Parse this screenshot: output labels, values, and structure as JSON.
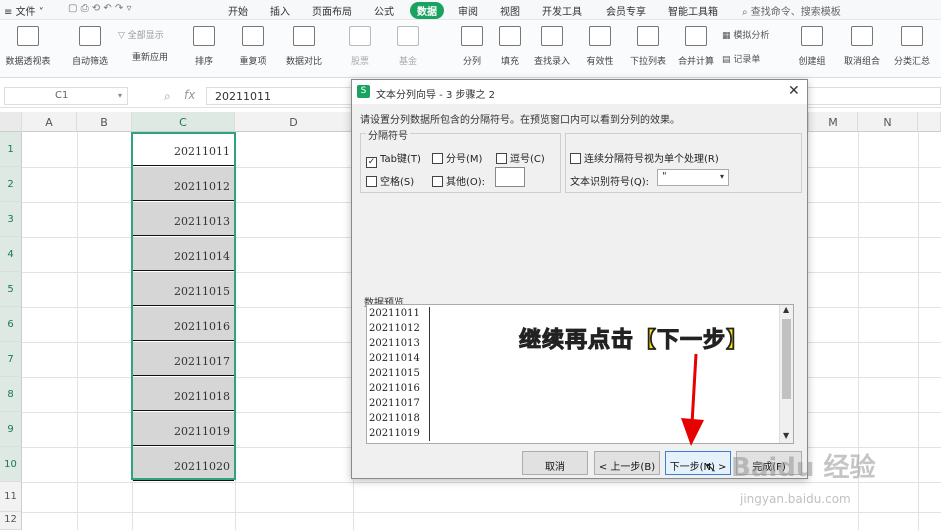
{
  "menubar": {
    "file": "文件",
    "items": [
      "开始",
      "插入",
      "页面布局",
      "公式",
      "数据",
      "审阅",
      "视图",
      "开发工具",
      "会员专享",
      "智能工具箱"
    ],
    "active": "数据",
    "search": "查找命令、搜索模板"
  },
  "ribbon": {
    "buttons": [
      "数据透视表",
      "自动筛选",
      "重新应用",
      "排序",
      "重复项",
      "数据对比",
      "股票",
      "基金",
      "分列",
      "填充",
      "查找录入",
      "有效性",
      "下拉列表",
      "合并计算",
      "记录单",
      "创建组",
      "取消组合",
      "分类汇总"
    ],
    "small": [
      "全部显示",
      "模拟分析"
    ]
  },
  "formula_bar": {
    "cell_ref": "C1",
    "fx": "fx",
    "value": "20211011"
  },
  "grid": {
    "columns": [
      "A",
      "B",
      "C",
      "D",
      "M",
      "N"
    ],
    "rows": [
      "1",
      "2",
      "3",
      "4",
      "5",
      "6",
      "7",
      "8",
      "9",
      "10",
      "11",
      "12"
    ],
    "c_values": [
      "20211011",
      "20211012",
      "20211013",
      "20211014",
      "20211015",
      "20211016",
      "20211017",
      "20211018",
      "20211019",
      "20211020"
    ]
  },
  "dialog": {
    "title": "文本分列向导 - 3 步骤之 2",
    "intro": "请设置分列数据所包含的分隔符号。在预览窗口内可以看到分列的效果。",
    "sep_group": "分隔符号",
    "tab": "Tab键(T)",
    "semicolon": "分号(M)",
    "comma": "逗号(C)",
    "space": "空格(S)",
    "other": "其他(O):",
    "consecutive": "连续分隔符号视为单个处理(R)",
    "qualifier_label": "文本识别符号(Q):",
    "qualifier_value": "\"",
    "preview_label": "数据预览",
    "preview_rows": [
      "20211011",
      "20211012",
      "20211013",
      "20211014",
      "20211015",
      "20211016",
      "20211017",
      "20211018",
      "20211019"
    ],
    "cancel": "取消",
    "back": "< 上一步(B)",
    "next": "下一步(N) >",
    "finish": "完成(F)"
  },
  "annotation": "继续再点击【下一步】",
  "watermark": {
    "brand": "Baidu 经验",
    "url": "jingyan.baidu.com"
  },
  "colors": {
    "accent": "#1aa260",
    "selection": "#2fa37a",
    "annotation": "#ffeb00",
    "arrow": "#e60000"
  }
}
